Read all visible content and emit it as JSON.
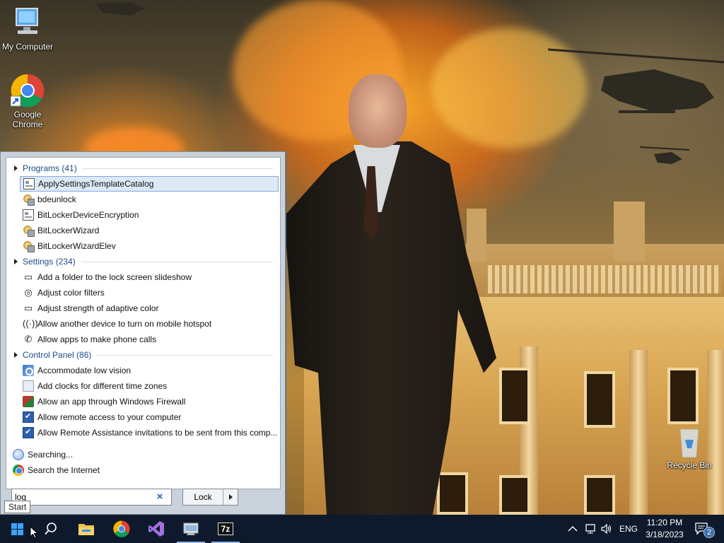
{
  "desktop": {
    "icons": [
      {
        "label": "My Computer",
        "icon": "computer-icon"
      },
      {
        "label": "Google Chrome",
        "icon": "chrome-icon"
      },
      {
        "label": "Recycle Bin",
        "icon": "recycle-bin-icon"
      }
    ]
  },
  "start_menu": {
    "groups": [
      {
        "header": "Programs (41)",
        "items": [
          {
            "label": "ApplySettingsTemplateCatalog",
            "icon": "app-icon",
            "selected": true
          },
          {
            "label": "bdeunlock",
            "icon": "bitlocker-keys-icon"
          },
          {
            "label": "BitLockerDeviceEncryption",
            "icon": "app-icon"
          },
          {
            "label": "BitLockerWizard",
            "icon": "bitlocker-keys-icon"
          },
          {
            "label": "BitLockerWizardElev",
            "icon": "bitlocker-keys-icon"
          }
        ]
      },
      {
        "header": "Settings (234)",
        "items": [
          {
            "label": "Add a folder to the lock screen slideshow",
            "icon": "monitor-icon"
          },
          {
            "label": "Adjust color filters",
            "icon": "color-palette-icon"
          },
          {
            "label": "Adjust strength of adaptive color",
            "icon": "monitor-icon"
          },
          {
            "label": "Allow another device to turn on mobile hotspot",
            "icon": "hotspot-icon"
          },
          {
            "label": "Allow apps to make phone calls",
            "icon": "phone-icon"
          }
        ]
      },
      {
        "header": "Control Panel (86)",
        "items": [
          {
            "label": "Accommodate low vision",
            "icon": "ease-of-access-icon"
          },
          {
            "label": "Add clocks for different time zones",
            "icon": "clock-icon"
          },
          {
            "label": "Allow an app through Windows Firewall",
            "icon": "firewall-icon"
          },
          {
            "label": "Allow remote access to your computer",
            "icon": "remote-access-icon"
          },
          {
            "label": "Allow Remote Assistance invitations to be sent from this comp..."
          }
        ]
      }
    ],
    "searching_label": "Searching...",
    "search_internet_label": "Search the Internet",
    "search_value": "log",
    "clear_symbol": "×",
    "power_button_label": "Lock"
  },
  "tooltip": "Start",
  "taskbar": {
    "pinned": [
      "start-button",
      "search-button",
      "file-explorer",
      "google-chrome",
      "visual-studio",
      "app-window",
      "7zip"
    ],
    "seven_zip_label": "7z",
    "tray": {
      "language": "ENG",
      "time": "11:20 PM",
      "date": "3/18/2023",
      "notification_count": "2"
    }
  }
}
